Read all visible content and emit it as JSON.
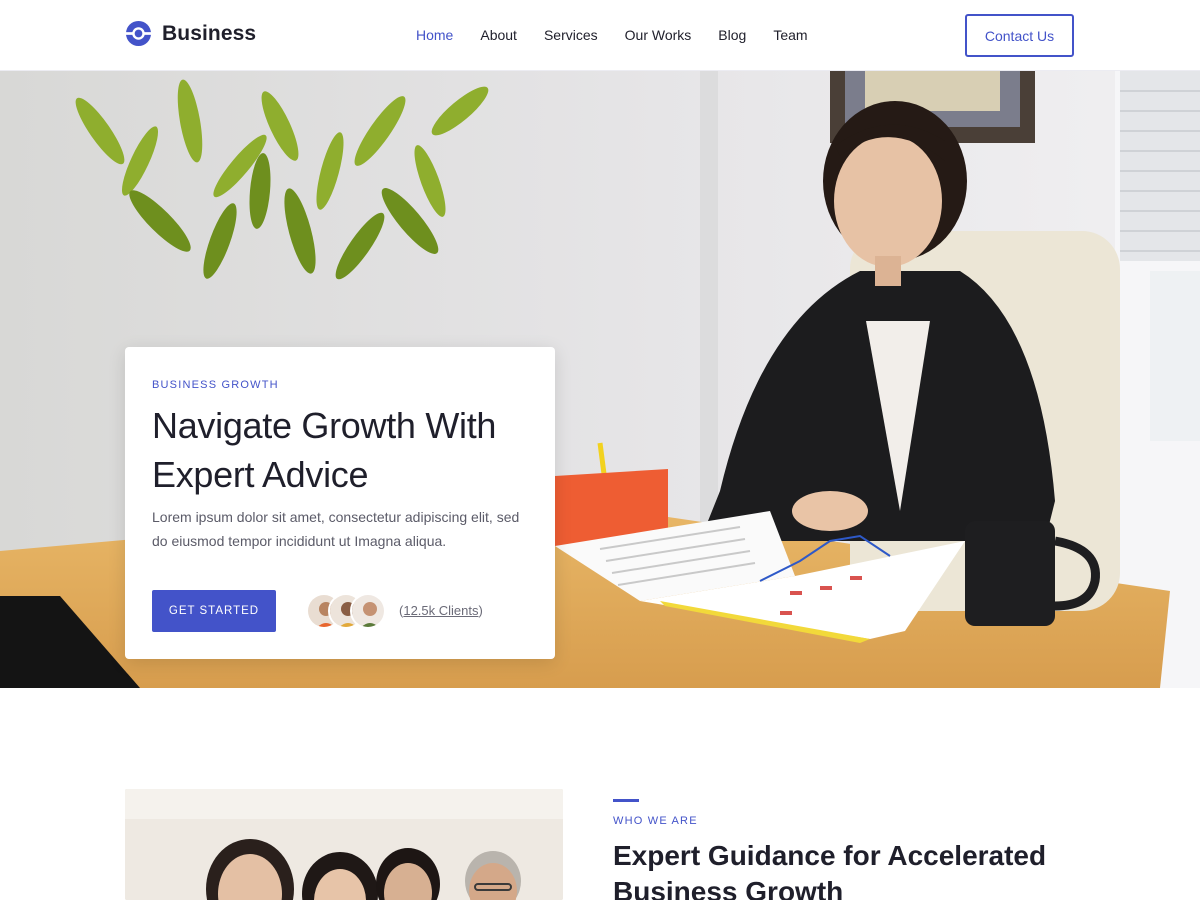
{
  "brand": {
    "name": "Business",
    "accent": "#4353c9"
  },
  "nav": {
    "items": [
      {
        "label": "Home",
        "active": true
      },
      {
        "label": "About",
        "active": false
      },
      {
        "label": "Services",
        "active": false
      },
      {
        "label": "Our Works",
        "active": false
      },
      {
        "label": "Blog",
        "active": false
      },
      {
        "label": "Team",
        "active": false
      }
    ],
    "contact_label": "Contact Us"
  },
  "hero": {
    "eyebrow": "BUSINESS GROWTH",
    "title": "Navigate Growth With Expert Advice",
    "description": "Lorem ipsum dolor sit amet, consectetur adipiscing elit, sed do eiusmod tempor incididunt ut Imagna aliqua.",
    "cta_label": "GET STARTED",
    "clients_label": "12.5k Clients"
  },
  "about": {
    "eyebrow": "WHO WE ARE",
    "title": "Expert Guidance for Accelerated Business Growth"
  }
}
